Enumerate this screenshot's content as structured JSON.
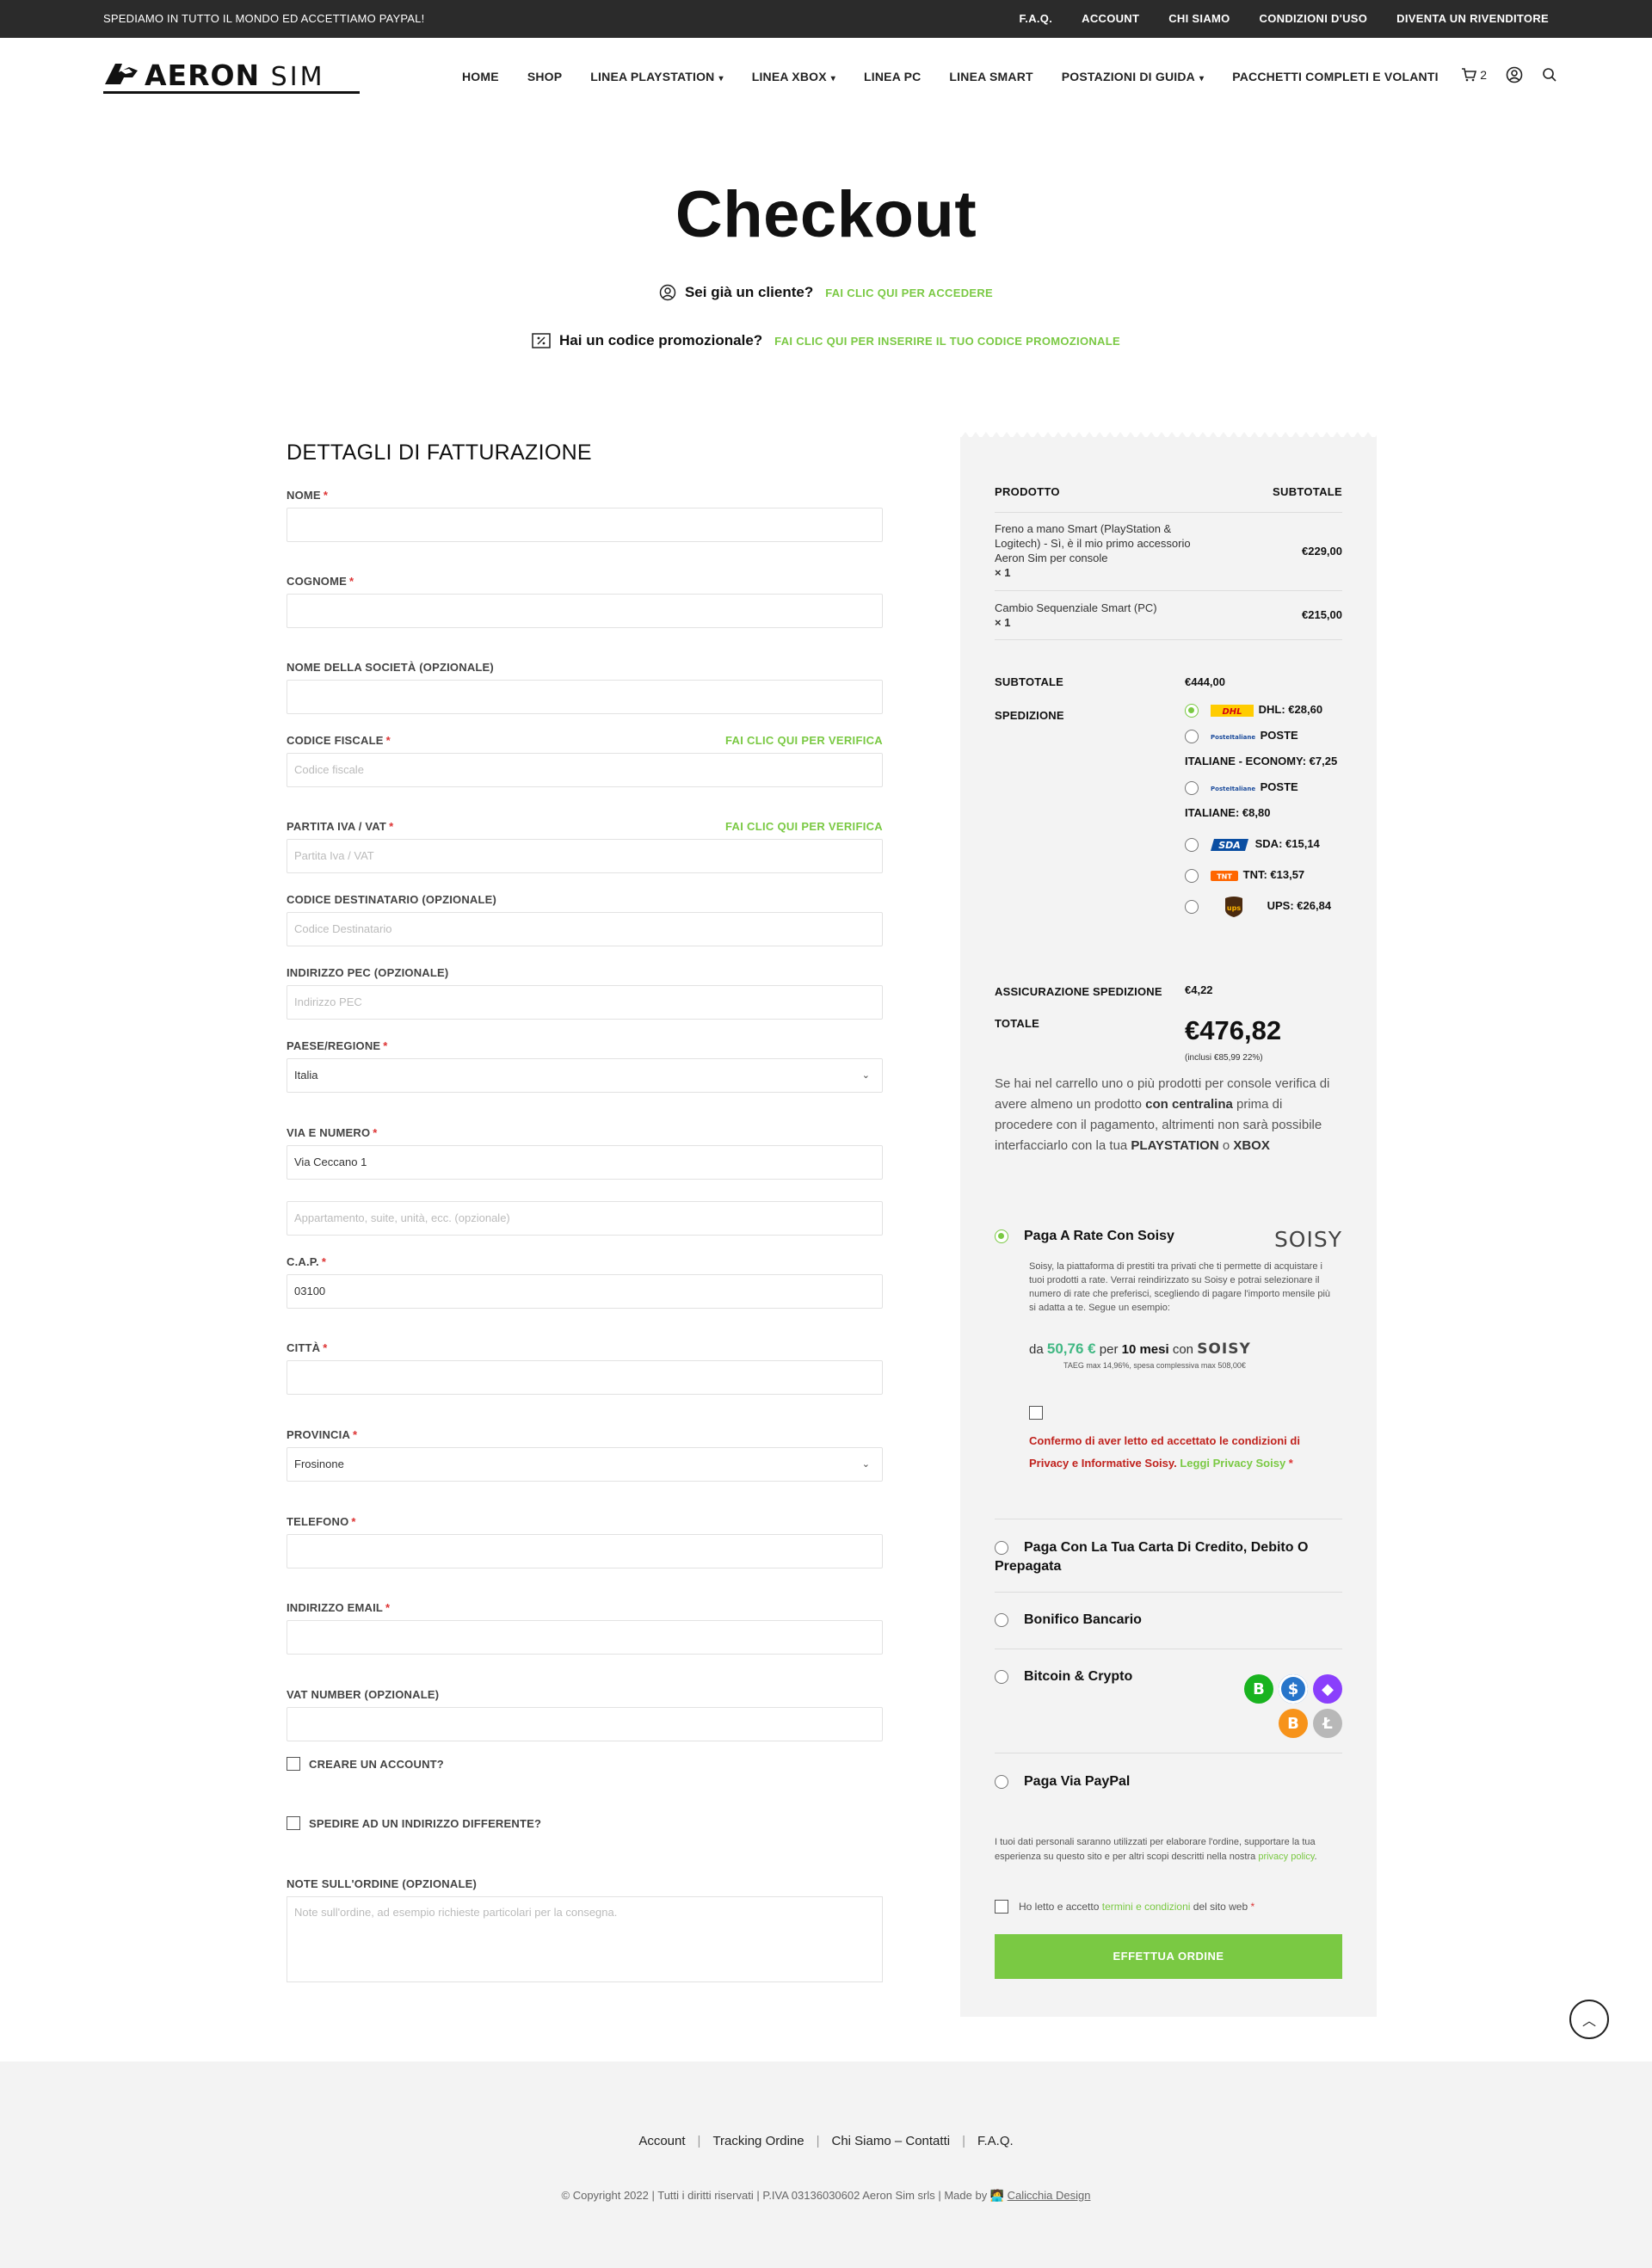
{
  "topbar": {
    "promo": "SPEDIAMO IN TUTTO IL MONDO ED ACCETTIAMO PAYPAL!",
    "links": [
      "F.A.Q.",
      "ACCOUNT",
      "CHI SIAMO",
      "CONDIZIONI D'USO",
      "DIVENTA UN RIVENDITORE"
    ]
  },
  "header": {
    "logo_text": "AERON",
    "logo_text2": "SIM",
    "nav": [
      {
        "label": "HOME",
        "dropdown": false
      },
      {
        "label": "SHOP",
        "dropdown": false
      },
      {
        "label": "LINEA PLAYSTATION",
        "dropdown": true
      },
      {
        "label": "LINEA XBOX",
        "dropdown": true
      },
      {
        "label": "LINEA PC",
        "dropdown": false
      },
      {
        "label": "LINEA SMART",
        "dropdown": false
      },
      {
        "label": "POSTAZIONI DI GUIDA",
        "dropdown": true
      },
      {
        "label": "PACCHETTI COMPLETI E VOLANTI",
        "dropdown": false
      }
    ],
    "cart_count": "2"
  },
  "page": {
    "title": "Checkout",
    "customer_q": "Sei già un cliente?",
    "customer_link": "FAI CLIC QUI PER ACCEDERE",
    "promo_q": "Hai un codice promozionale?",
    "promo_link": "FAI CLIC QUI PER INSERIRE IL TUO CODICE PROMOZIONALE"
  },
  "billing": {
    "heading": "DETTAGLI DI FATTURAZIONE",
    "verify_link": "FAI CLIC QUI PER VERIFICA",
    "fields": {
      "nome": {
        "label": "NOME",
        "value": ""
      },
      "cognome": {
        "label": "COGNOME",
        "value": ""
      },
      "societa": {
        "label": "NOME DELLA SOCIETÀ (OPZIONALE)",
        "value": ""
      },
      "cf": {
        "label": "CODICE FISCALE",
        "placeholder": "Codice fiscale"
      },
      "piva": {
        "label": "PARTITA IVA / VAT",
        "placeholder": "Partita Iva / VAT"
      },
      "dest": {
        "label": "CODICE DESTINATARIO (OPZIONALE)",
        "placeholder": "Codice Destinatario"
      },
      "pec": {
        "label": "INDIRIZZO PEC (OPZIONALE)",
        "placeholder": "Indirizzo PEC"
      },
      "paese": {
        "label": "PAESE/REGIONE",
        "value": "Italia"
      },
      "via": {
        "label": "VIA E NUMERO",
        "value": "Via Ceccano 1"
      },
      "apt": {
        "placeholder": "Appartamento, suite, unità, ecc. (opzionale)"
      },
      "cap": {
        "label": "C.A.P.",
        "value": "03100"
      },
      "citta": {
        "label": "CITTÀ",
        "value": ""
      },
      "provincia": {
        "label": "PROVINCIA",
        "value": "Frosinone"
      },
      "telefono": {
        "label": "TELEFONO",
        "value": ""
      },
      "email": {
        "label": "INDIRIZZO EMAIL",
        "value": ""
      },
      "vat": {
        "label": "VAT NUMBER (OPZIONALE)",
        "value": ""
      }
    },
    "create_account": "CREARE UN ACCOUNT?",
    "ship_different": "SPEDIRE AD UN INDIRIZZO DIFFERENTE?",
    "notes_label": "NOTE SULL'ORDINE (OPZIONALE)",
    "notes_placeholder": "Note sull'ordine, ad esempio richieste particolari per la consegna."
  },
  "summary": {
    "col_product": "PRODOTTO",
    "col_subtotal": "SUBTOTALE",
    "items": [
      {
        "name": "Freno a mano Smart (PlayStation & Logitech) - Sì, è il mio primo accessorio Aeron Sim per console",
        "qty": "× 1",
        "price": "€229,00"
      },
      {
        "name": "Cambio Sequenziale Smart (PC)",
        "qty": "× 1",
        "price": "€215,00"
      }
    ],
    "subtotal_label": "SUBTOTALE",
    "subtotal_value": "€444,00",
    "shipping_label": "SPEDIZIONE",
    "shipping": [
      {
        "label": "DHL: €28,60",
        "selected": true
      },
      {
        "label": "POSTE ITALIANE - ECONOMY: €7,25",
        "selected": false
      },
      {
        "label": "POSTE ITALIANE: €8,80",
        "selected": false
      },
      {
        "label": "SDA: €15,14",
        "selected": false
      },
      {
        "label": "TNT: €13,57",
        "selected": false
      },
      {
        "label": "UPS: €26,84",
        "selected": false
      }
    ],
    "carrier_icons": [
      "dhl-logo",
      "poste-italiane-logo",
      "poste-italiane-logo",
      "sda-logo",
      "tnt-logo",
      "ups-logo"
    ],
    "insurance_label": "ASSICURAZIONE SPEDIZIONE",
    "insurance_value": "€4,22",
    "total_label": "TOTALE",
    "total_value": "€476,82",
    "tax_note": "(inclusi €85,99 22%)",
    "console_note_1": "Se hai nel carrello uno o più prodotti per console verifica di avere almeno un prodotto ",
    "console_note_b1": "con centralina",
    "console_note_2": " prima di procedere con il pagamento, altrimenti non sarà possibile interfacciarlo con la tua ",
    "console_note_b2": "PLAYSTATION",
    "console_note_3": " o ",
    "console_note_b3": "XBOX"
  },
  "payments": {
    "soisy_title": "Paga A Rate Con Soisy",
    "soisy_logo": "SOISY",
    "soisy_desc": "Soisy, la piattaforma di prestiti tra privati che ti permette di acquistare i tuoi prodotti a rate. Verrai reindirizzato su Soisy e potrai selezionare il numero di rate che preferisci, scegliendo di pagare l'importo mensile più si adatta a te. Segue un esempio:",
    "soisy_da": "da ",
    "soisy_amount": "50,76 €",
    "soisy_per": " per ",
    "soisy_months": "10 mesi",
    "soisy_con": " con ",
    "soisy_taeg": "TAEG max 14,96%, spesa complessiva max 508,00€",
    "soisy_consent": "Confermo di aver letto ed accettato le condizioni di Privacy e Informative Soisy. ",
    "soisy_read": "Leggi Privacy Soisy",
    "card_title": "Paga Con La Tua Carta Di Credito, Debito O Prepagata",
    "bank_title": "Bonifico Bancario",
    "crypto_title": "Bitcoin & Crypto",
    "paypal_title": "Paga Via PayPal",
    "crypto_icons": [
      "bitcoin-cash-icon",
      "usdc-icon",
      "ethereum-icon",
      "bitcoin-icon",
      "litecoin-icon"
    ],
    "privacy_text": "I tuoi dati personali saranno utilizzati per elaborare l'ordine, supportare la tua esperienza su questo sito e per altri scopi descritti nella nostra ",
    "privacy_link": "privacy policy",
    "terms_text": "Ho letto e accetto ",
    "terms_link": "termini e condizioni",
    "terms_tail": " del sito web",
    "order_button": "EFFETTUA ORDINE"
  },
  "footer": {
    "links": [
      "Account",
      "Tracking Ordine",
      "Chi Siamo – Contatti",
      "F.A.Q."
    ],
    "copyright": "© Copyright 2022 | Tutti i diritti riservati | P.IVA 03136030602 Aeron Sim srls | Made by ",
    "credit": "Calicchia Design"
  },
  "colors": {
    "accent": "#7ac943",
    "topbar": "#2b2b2b",
    "summary_bg": "#f3f3f3",
    "consent_red": "#c0221d"
  }
}
